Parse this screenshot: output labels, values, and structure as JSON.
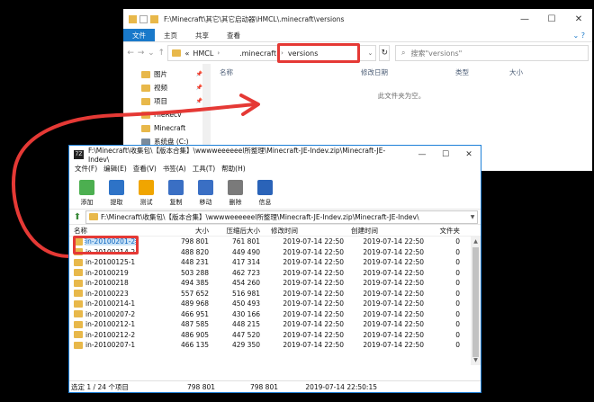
{
  "explorer": {
    "title_path": "F:\\Minecraft\\其它\\其它启动器\\HMCL\\.minecraft\\versions",
    "tabs": [
      "文件",
      "主页",
      "共享",
      "查看"
    ],
    "breadcrumb": [
      "«",
      "HMCL",
      ".minecraft",
      "versions"
    ],
    "search_placeholder": "搜索\"versions\"",
    "nav_items": [
      {
        "label": "图片",
        "pinned": true
      },
      {
        "label": "视频",
        "pinned": true
      },
      {
        "label": "项目",
        "pinned": true
      },
      {
        "label": "FileRecv",
        "pinned": false
      },
      {
        "label": "Minecraft",
        "pinned": false
      },
      {
        "label": "系统盘 (C:)",
        "pinned": false
      }
    ],
    "columns": [
      "名称",
      "修改日期",
      "类型",
      "大小"
    ],
    "empty_message": "此文件夹为空。"
  },
  "archive": {
    "title": "F:\\Minecraft\\收集包\\【版本合集】\\wwwweeeeeel所整理\\Minecraft-JE-Indev.zip\\Minecraft-JE-Indev\\",
    "logo_text": "7Z",
    "menu": [
      "文件(F)",
      "编辑(E)",
      "查看(V)",
      "书签(A)",
      "工具(T)",
      "帮助(H)"
    ],
    "tools": [
      {
        "label": "添加",
        "icon": "add-icon",
        "color": "#4caf50"
      },
      {
        "label": "提取",
        "icon": "extract-icon",
        "color": "#2e73c7"
      },
      {
        "label": "测试",
        "icon": "test-icon",
        "color": "#f0a500"
      },
      {
        "label": "复制",
        "icon": "copy-icon",
        "color": "#3a6fc4"
      },
      {
        "label": "移动",
        "icon": "move-icon",
        "color": "#3a6fc4"
      },
      {
        "label": "删除",
        "icon": "delete-icon",
        "color": "#7a7a7a"
      },
      {
        "label": "信息",
        "icon": "info-icon",
        "color": "#2a63b8"
      }
    ],
    "path": "F:\\Minecraft\\收集包\\【版本合集】\\wwwweeeeeel所整理\\Minecraft-JE-Indev.zip\\Minecraft-JE-Indev\\",
    "columns": [
      "名称",
      "大小",
      "压缩后大小",
      "修改时间",
      "创建时间",
      "文件夹"
    ],
    "rows": [
      {
        "name": "in-20100201-2",
        "size": "798 801",
        "packed": "761 801",
        "modified": "2019-07-14 22:50",
        "created": "2019-07-14 22:50",
        "folders": "0",
        "selected": true
      },
      {
        "name": "in-20100214-2",
        "size": "488 820",
        "packed": "449 490",
        "modified": "2019-07-14 22:50",
        "created": "2019-07-14 22:50",
        "folders": "0"
      },
      {
        "name": "in-20100125-1",
        "size": "448 231",
        "packed": "417 314",
        "modified": "2019-07-14 22:50",
        "created": "2019-07-14 22:50",
        "folders": "0"
      },
      {
        "name": "in-20100219",
        "size": "503 288",
        "packed": "462 723",
        "modified": "2019-07-14 22:50",
        "created": "2019-07-14 22:50",
        "folders": "0"
      },
      {
        "name": "in-20100218",
        "size": "494 385",
        "packed": "454 260",
        "modified": "2019-07-14 22:50",
        "created": "2019-07-14 22:50",
        "folders": "0"
      },
      {
        "name": "in-20100223",
        "size": "557 652",
        "packed": "516 981",
        "modified": "2019-07-14 22:50",
        "created": "2019-07-14 22:50",
        "folders": "0"
      },
      {
        "name": "in-20100214-1",
        "size": "489 968",
        "packed": "450 493",
        "modified": "2019-07-14 22:50",
        "created": "2019-07-14 22:50",
        "folders": "0"
      },
      {
        "name": "in-20100207-2",
        "size": "466 951",
        "packed": "430 166",
        "modified": "2019-07-14 22:50",
        "created": "2019-07-14 22:50",
        "folders": "0"
      },
      {
        "name": "in-20100212-1",
        "size": "487 585",
        "packed": "448 215",
        "modified": "2019-07-14 22:50",
        "created": "2019-07-14 22:50",
        "folders": "0"
      },
      {
        "name": "in-20100212-2",
        "size": "486 905",
        "packed": "447 520",
        "modified": "2019-07-14 22:50",
        "created": "2019-07-14 22:50",
        "folders": "0"
      },
      {
        "name": "in-20100207-1",
        "size": "466 135",
        "packed": "429 350",
        "modified": "2019-07-14 22:50",
        "created": "2019-07-14 22:50",
        "folders": "0"
      }
    ],
    "status": {
      "selection": "选定 1 / 24 个项目",
      "size": "798 801",
      "packed": "798 801",
      "time": "2019-07-14 22:50:15"
    }
  },
  "colors": {
    "accent_blue": "#1979ca",
    "highlight_red": "#e53935",
    "folder": "#e8b84a"
  }
}
